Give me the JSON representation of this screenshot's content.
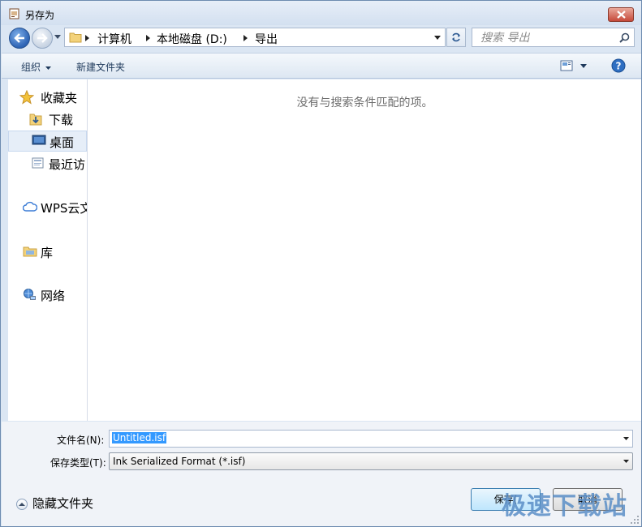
{
  "window": {
    "title": "另存为"
  },
  "address": {
    "crumbs": [
      "计算机",
      "本地磁盘 (D:)",
      "导出"
    ]
  },
  "search": {
    "placeholder": "搜索 导出"
  },
  "toolbar": {
    "organize_label": "组织",
    "new_folder_label": "新建文件夹"
  },
  "sidebar": {
    "items": [
      {
        "label": "收藏夹",
        "icon": "star-icon"
      },
      {
        "label": "下载",
        "icon": "download-folder-icon"
      },
      {
        "label": "桌面",
        "icon": "desktop-icon",
        "selected": true
      },
      {
        "label": "最近访",
        "icon": "recent-places-icon"
      },
      {
        "label": "WPS云文",
        "icon": "cloud-icon"
      },
      {
        "label": "库",
        "icon": "library-icon"
      },
      {
        "label": "网络",
        "icon": "network-icon"
      }
    ]
  },
  "main": {
    "empty_message": "没有与搜索条件匹配的项。"
  },
  "form": {
    "filename_label": "文件名(N):",
    "filename_value": "Untitled.isf",
    "filetype_label": "保存类型(T):",
    "filetype_value": "Ink Serialized Format (*.isf)"
  },
  "footer": {
    "hide_folders_label": "隐藏文件夹",
    "save_label": "保存(",
    "cancel_label": "取消"
  },
  "watermark": {
    "text": "极速下载站"
  },
  "colors": {
    "accent": "#3399ff",
    "toolbar_text": "#1e395b",
    "close": "#c6493a"
  }
}
